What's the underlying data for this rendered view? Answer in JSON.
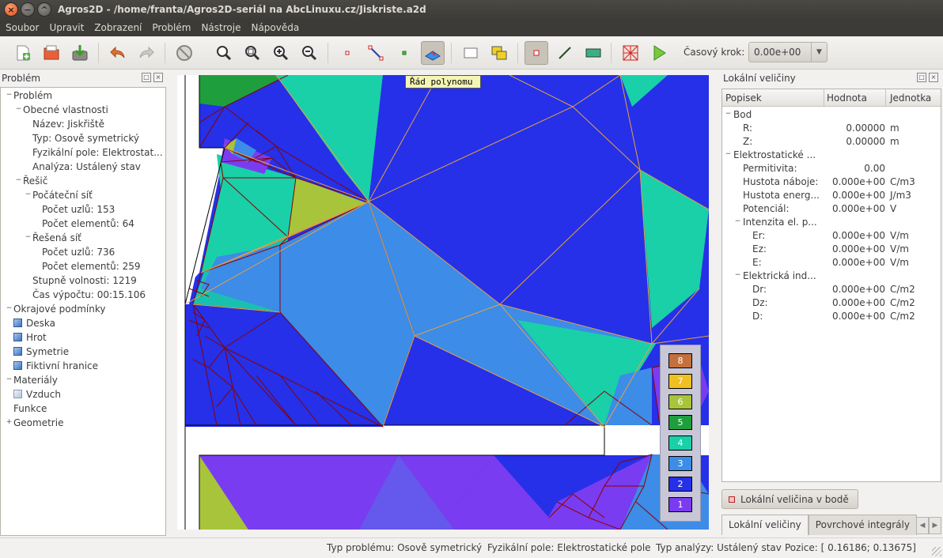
{
  "window": {
    "title": "Agros2D - /home/franta/Agros2D-seriál na AbcLinuxu.cz/Jiskriste.a2d"
  },
  "menu": [
    "Soubor",
    "Upravit",
    "Zobrazení",
    "Problém",
    "Nástroje",
    "Nápověda"
  ],
  "toolbar": {
    "time_step_label": "Časový krok:",
    "time_step_value": "0.00e+00"
  },
  "canvas_tooltip": "Řád polynomu",
  "problem_panel": {
    "title": "Problém",
    "tree": [
      {
        "label": "Problém",
        "level": 0,
        "toggle": "−"
      },
      {
        "label": "Obecné vlastnosti",
        "level": 1,
        "toggle": "−"
      },
      {
        "label": "Název: Jiskřiště",
        "level": 2
      },
      {
        "label": "Typ: Osově symetrický",
        "level": 2
      },
      {
        "label": "Fyzikální pole: Elektrostat...",
        "level": 2
      },
      {
        "label": "Analýza: Ustálený stav",
        "level": 2
      },
      {
        "label": "Řešič",
        "level": 1,
        "toggle": "−"
      },
      {
        "label": "Počáteční síť",
        "level": 2,
        "toggle": "−"
      },
      {
        "label": "Počet uzlů: 153",
        "level": 3
      },
      {
        "label": "Počet elementů: 64",
        "level": 3
      },
      {
        "label": "Řešená síť",
        "level": 2,
        "toggle": "−"
      },
      {
        "label": "Počet uzlů: 736",
        "level": 3
      },
      {
        "label": "Počet elementů: 259",
        "level": 3
      },
      {
        "label": "Stupně volnosti: 1219",
        "level": 2
      },
      {
        "label": "Čas výpočtu: 00:15.106",
        "level": 2
      },
      {
        "label": "Okrajové podmínky",
        "level": 0,
        "toggle": "−"
      },
      {
        "label": "Deska",
        "level": 2,
        "icon": "boundary-cube-icon"
      },
      {
        "label": "Hrot",
        "level": 2,
        "icon": "boundary-cube-icon"
      },
      {
        "label": "Symetrie",
        "level": 2,
        "icon": "boundary-cube-icon"
      },
      {
        "label": "Fiktivní hranice",
        "level": 2,
        "icon": "boundary-cube-icon"
      },
      {
        "label": "Materiály",
        "level": 0,
        "toggle": "−"
      },
      {
        "label": "Vzduch",
        "level": 2,
        "icon": "material-cube-icon"
      },
      {
        "label": "Funkce",
        "level": 0
      },
      {
        "label": "Geometrie",
        "level": 0,
        "toggle": "+"
      }
    ]
  },
  "local_panel": {
    "title": "Lokální veličiny",
    "columns": [
      "Popisek",
      "Hodnota",
      "Jednotka"
    ],
    "rows": [
      {
        "label": "Bod",
        "value": "",
        "unit": "",
        "level": 0,
        "toggle": "−"
      },
      {
        "label": "R:",
        "value": "0.00000",
        "unit": "m",
        "level": 1
      },
      {
        "label": "Z:",
        "value": "0.00000",
        "unit": "m",
        "level": 1
      },
      {
        "label": "Elektrostatické ...",
        "value": "",
        "unit": "",
        "level": 0,
        "toggle": "−"
      },
      {
        "label": "Permitivita:",
        "value": "0.00",
        "unit": "",
        "level": 1
      },
      {
        "label": "Hustota náboje:",
        "value": "0.000e+00",
        "unit": "C/m3",
        "level": 1
      },
      {
        "label": "Hustota energ...",
        "value": "0.000e+00",
        "unit": "J/m3",
        "level": 1
      },
      {
        "label": "Potenciál:",
        "value": "0.000e+00",
        "unit": "V",
        "level": 1
      },
      {
        "label": "Intenzita el. p...",
        "value": "",
        "unit": "",
        "level": 1,
        "toggle": "−"
      },
      {
        "label": "Er:",
        "value": "0.000e+00",
        "unit": "V/m",
        "level": 2
      },
      {
        "label": "Ez:",
        "value": "0.000e+00",
        "unit": "V/m",
        "level": 2
      },
      {
        "label": "E:",
        "value": "0.000e+00",
        "unit": "V/m",
        "level": 2
      },
      {
        "label": "Elektrická ind...",
        "value": "",
        "unit": "",
        "level": 1,
        "toggle": "−"
      },
      {
        "label": "Dr:",
        "value": "0.000e+00",
        "unit": "C/m2",
        "level": 2
      },
      {
        "label": "Dz:",
        "value": "0.000e+00",
        "unit": "C/m2",
        "level": 2
      },
      {
        "label": "D:",
        "value": "0.000e+00",
        "unit": "C/m2",
        "level": 2
      }
    ],
    "button": "Lokální veličina v bodě",
    "tabs": [
      "Lokální veličiny",
      "Povrchové integrály"
    ]
  },
  "legend": [
    {
      "label": "8",
      "color": "#c4703e"
    },
    {
      "label": "7",
      "color": "#f0c020"
    },
    {
      "label": "6",
      "color": "#a8c43a"
    },
    {
      "label": "5",
      "color": "#1f9e3e"
    },
    {
      "label": "4",
      "color": "#19d0a8"
    },
    {
      "label": "3",
      "color": "#3c8ce8"
    },
    {
      "label": "2",
      "color": "#2530e8"
    },
    {
      "label": "1",
      "color": "#7a3cf0"
    }
  ],
  "statusbar": {
    "problem_type": "Typ problému: Osově symetrický",
    "field": "Fyzikální pole: Elektrostatické pole",
    "analysis": "Typ analýzy: Ustálený stav",
    "position": "Pozice: [ 0.16186;  0.13675]"
  }
}
